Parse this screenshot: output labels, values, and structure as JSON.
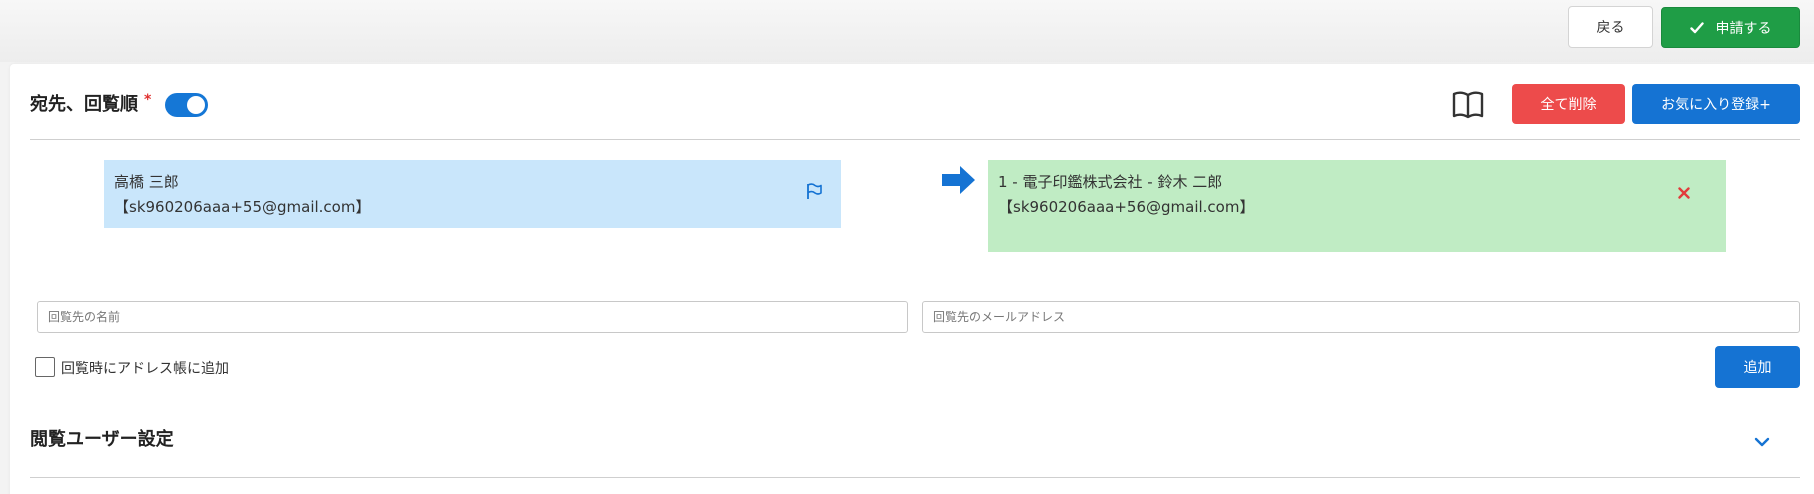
{
  "header": {
    "back_label": "戻る",
    "apply_label": "申請する"
  },
  "recipients_section": {
    "title": "宛先、回覧順",
    "required_mark": "*",
    "toggle_on": true,
    "delete_all_label": "全て削除",
    "favorite_label": "お気に入り登録+"
  },
  "sender": {
    "name": "高橋 三郎",
    "email": "【sk960206aaa+55@gmail.com】"
  },
  "recipient": {
    "name": "1 - 電子印鑑株式会社 - 鈴木 二郎",
    "email": "【sk960206aaa+56@gmail.com】"
  },
  "form": {
    "name_placeholder": "回覧先の名前",
    "email_placeholder": "回覧先のメールアドレス",
    "checkbox_label": "回覧時にアドレス帳に追加",
    "checkbox_checked": false,
    "add_label": "追加"
  },
  "viewer_section": {
    "title": "閲覧ユーザー設定"
  },
  "colors": {
    "primary": "#1573d3",
    "success": "#1f9d46",
    "danger": "#ed4b4b",
    "sender_bg": "#c9e6fb",
    "recipient_bg": "#c0ecc4"
  }
}
